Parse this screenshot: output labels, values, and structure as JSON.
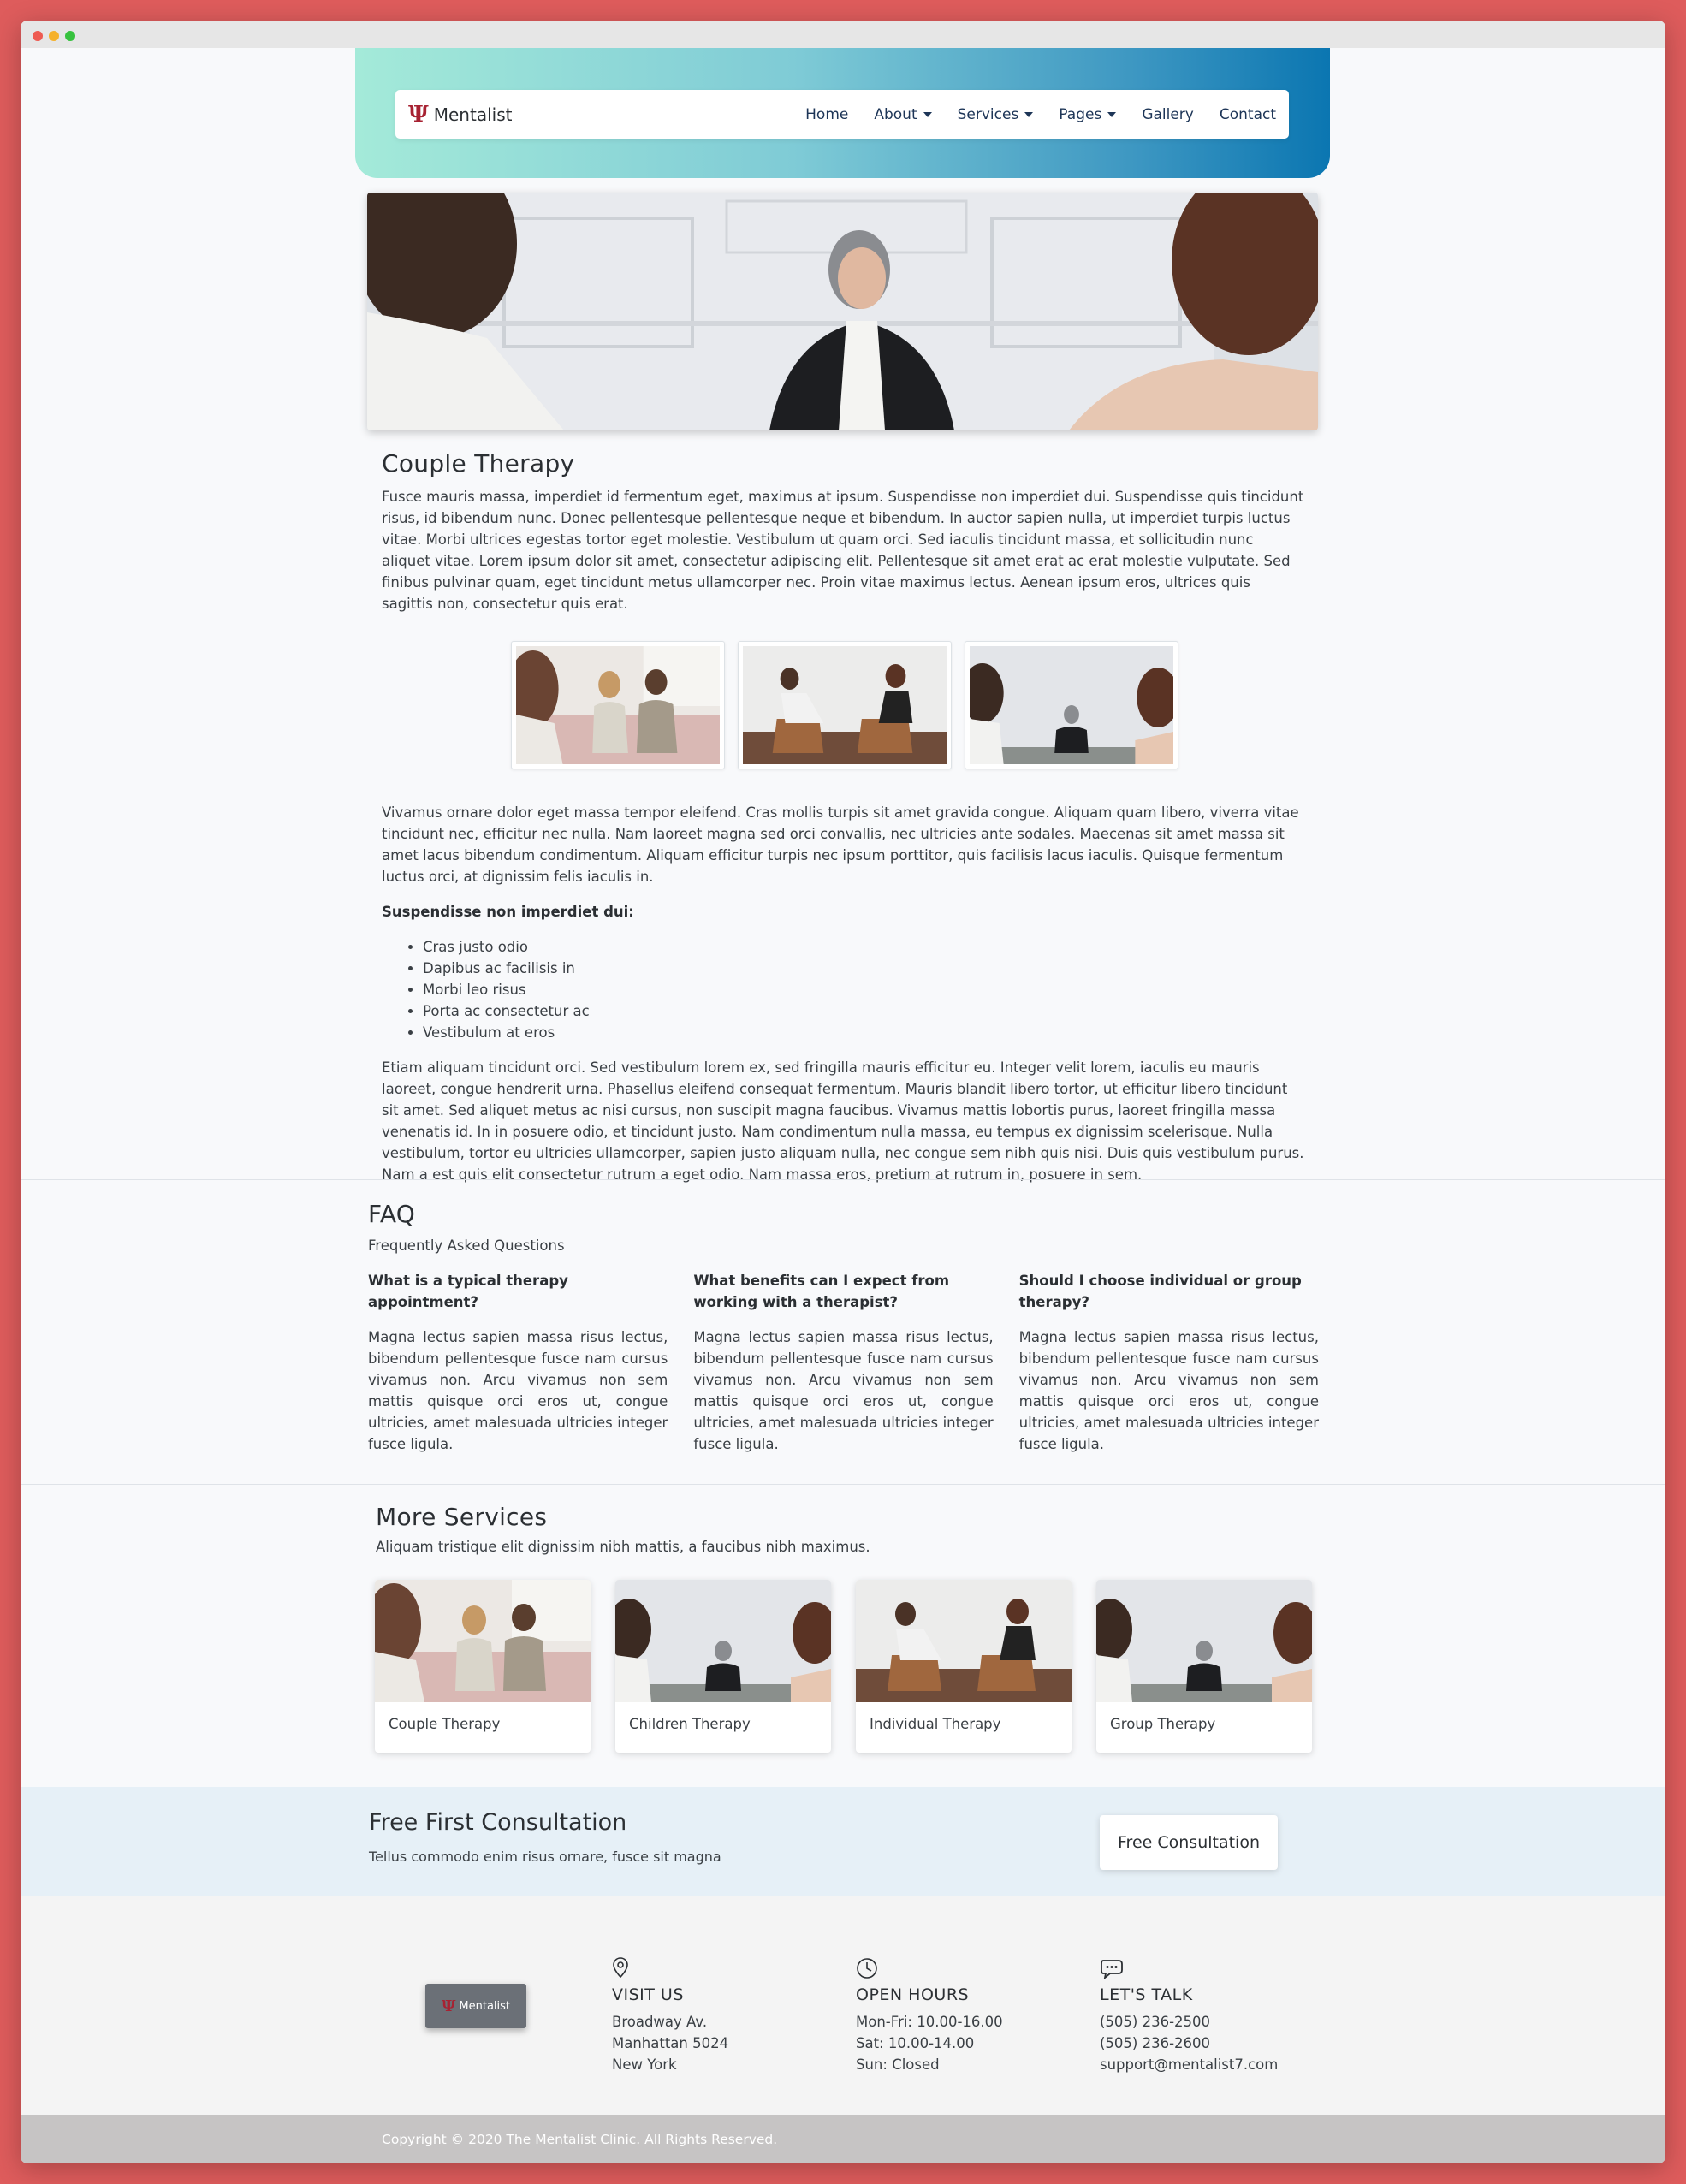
{
  "brand": {
    "name": "Mentalist",
    "logo_glyph": "Ψ",
    "accent_color": "#a72232"
  },
  "nav": {
    "items": [
      {
        "label": "Home",
        "dropdown": false
      },
      {
        "label": "About",
        "dropdown": true
      },
      {
        "label": "Services",
        "dropdown": true
      },
      {
        "label": "Pages",
        "dropdown": true
      },
      {
        "label": "Gallery",
        "dropdown": false
      },
      {
        "label": "Contact",
        "dropdown": false
      }
    ]
  },
  "article": {
    "title": "Couple Therapy",
    "intro": "Fusce mauris massa, imperdiet id fermentum eget, maximus at ipsum. Suspendisse non imperdiet dui. Suspendisse quis tincidunt risus, id bibendum nunc. Donec pellentesque pellentesque neque et bibendum. In auctor sapien nulla, ut imperdiet turpis luctus vitae. Morbi ultrices egestas tortor eget molestie. Vestibulum ut quam orci. Sed iaculis tincidunt massa, et sollicitudin nunc aliquet vitae. Lorem ipsum dolor sit amet, consectetur adipiscing elit. Pellentesque sit amet erat ac erat molestie vulputate. Sed finibus pulvinar quam, eget tincidunt metus ullamcorper nec. Proin vitae maximus lectus. Aenean ipsum eros, ultrices quis sagittis non, consectetur quis erat.",
    "body": "Vivamus ornare dolor eget massa tempor eleifend. Cras mollis turpis sit amet gravida congue. Aliquam quam libero, viverra vitae tincidunt nec, efficitur nec nulla. Nam laoreet magna sed orci convallis, nec ultricies ante sodales. Maecenas sit amet massa sit amet lacus bibendum condimentum. Aliquam efficitur turpis nec ipsum porttitor, quis facilisis lacus iaculis. Quisque fermentum luctus orci, at dignissim felis iaculis in.",
    "list_heading": "Suspendisse non imperdiet dui:",
    "list": [
      "Cras justo odio",
      "Dapibus ac facilisis in",
      "Morbi leo risus",
      "Porta ac consectetur ac",
      "Vestibulum at eros"
    ],
    "closing": "Etiam aliquam tincidunt orci. Sed vestibulum lorem ex, sed fringilla mauris efficitur eu. Integer velit lorem, iaculis eu mauris laoreet, congue hendrerit urna. Phasellus eleifend consequat fermentum. Mauris blandit libero tortor, ut efficitur libero tincidunt sit amet. Sed aliquet metus ac nisi cursus, non suscipit magna faucibus. Vivamus mattis lobortis purus, laoreet fringilla massa venenatis id. In in posuere odio, et tincidunt justo. Nam condimentum nulla massa, eu tempus ex dignissim scelerisque. Nulla vestibulum, tortor eu ultricies ullamcorper, sapien justo aliquam nulla, nec congue sem nibh quis nisi. Duis quis vestibulum purus. Nam a est quis elit consectetur rutrum a eget odio. Nam massa eros, pretium at rutrum in, posuere in sem."
  },
  "faq": {
    "title": "FAQ",
    "subtitle": "Frequently Asked Questions",
    "items": [
      {
        "q": "What is a typical therapy appointment?",
        "a": "Magna lectus sapien massa risus lectus, bibendum pellentesque fusce nam cursus vivamus non. Arcu vivamus non sem mattis quisque orci eros ut, congue ultricies, amet malesuada ultricies integer fusce ligula."
      },
      {
        "q": "What benefits can I expect from working with a therapist?",
        "a": "Magna lectus sapien massa risus lectus, bibendum pellentesque fusce nam cursus vivamus non. Arcu vivamus non sem mattis quisque orci eros ut, congue ultricies, amet malesuada ultricies integer fusce ligula."
      },
      {
        "q": "Should I choose individual or group therapy?",
        "a": "Magna lectus sapien massa risus lectus, bibendum pellentesque fusce nam cursus vivamus non. Arcu vivamus non sem mattis quisque orci eros ut, congue ultricies, amet malesuada ultricies integer fusce ligula."
      }
    ]
  },
  "services": {
    "title": "More Services",
    "subtitle": "Aliquam tristique elit dignissim nibh mattis, a faucibus nibh maximus.",
    "cards": [
      {
        "label": "Couple Therapy"
      },
      {
        "label": "Children Therapy"
      },
      {
        "label": "Individual Therapy"
      },
      {
        "label": "Group Therapy"
      }
    ]
  },
  "cta": {
    "title": "Free First Consultation",
    "subtitle": "Tellus commodo enim risus ornare, fusce sit magna",
    "button": "Free Consultation"
  },
  "footer": {
    "logo_text": "Mentalist",
    "visit": {
      "icon": "map-pin-icon",
      "title": "VISIT US",
      "lines": [
        "Broadway Av.",
        "Manhattan 5024",
        "New York"
      ]
    },
    "hours": {
      "icon": "clock-icon",
      "title": "OPEN HOURS",
      "lines": [
        "Mon-Fri: 10.00-16.00",
        "Sat: 10.00-14.00",
        "Sun: Closed"
      ]
    },
    "talk": {
      "icon": "chat-icon",
      "title": "LET'S TALK",
      "lines": [
        "(505) 236-2500",
        "(505) 236-2600",
        "support@mentalist7.com"
      ]
    },
    "copyright": "Copyright © 2020 The Mentalist Clinic. All Rights Reserved."
  }
}
